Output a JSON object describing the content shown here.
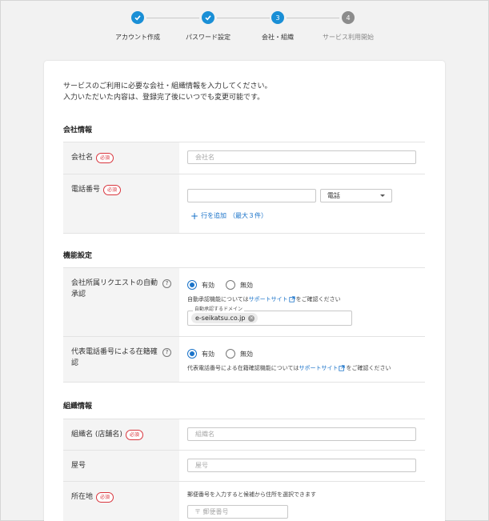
{
  "stepper": {
    "steps": [
      {
        "label": "アカウント作成",
        "state": "done",
        "number": "1"
      },
      {
        "label": "パスワード設定",
        "state": "done",
        "number": "2"
      },
      {
        "label": "会社・組織",
        "state": "current",
        "number": "3"
      },
      {
        "label": "サービス利用開始",
        "state": "todo",
        "number": "4"
      }
    ],
    "check_icon": "check-icon"
  },
  "intro": {
    "line1": "サービスのご利用に必要な会社・組織情報を入力してください。",
    "line2": "入力いただいた内容は、登録完了後にいつでも変更可能です。"
  },
  "required_badge": "必須",
  "company": {
    "title": "会社情報",
    "name_label": "会社名",
    "name_placeholder": "会社名",
    "phone_label": "電話番号",
    "phone_value": "",
    "phone_type": "電話",
    "add_row_label": "行を追加",
    "add_row_note": "（最大３件）"
  },
  "features": {
    "title": "機能設定",
    "auto_approve_label": "会社所属リクエストの自動承認",
    "on_label": "有効",
    "off_label": "無効",
    "auto_approve_value": "有効",
    "auto_approve_note_prefix": "自動承認機能については",
    "support_site": "サポートサイト",
    "note_suffix": "をご確認ください",
    "domain_legend": "自動承認するドメイン",
    "domain_chip": "e-seikatsu.co.jp",
    "phone_verify_label": "代表電話番号による在籍確認",
    "phone_verify_value": "有効",
    "phone_verify_note_prefix": "代表電話番号による在籍確認機能については"
  },
  "organization": {
    "title": "組織情報",
    "org_name_label": "組織名 (店舗名)",
    "org_name_placeholder": "組織名",
    "trade_name_label": "屋号",
    "trade_name_placeholder": "屋号",
    "address_label": "所在地",
    "address_note": "郵便番号を入力すると候補から住所を選択できます",
    "postal_placeholder": "〒 郵便番号"
  },
  "colors": {
    "accent": "#1a8fd6",
    "link": "#1a73c9",
    "required": "#d9363e"
  }
}
